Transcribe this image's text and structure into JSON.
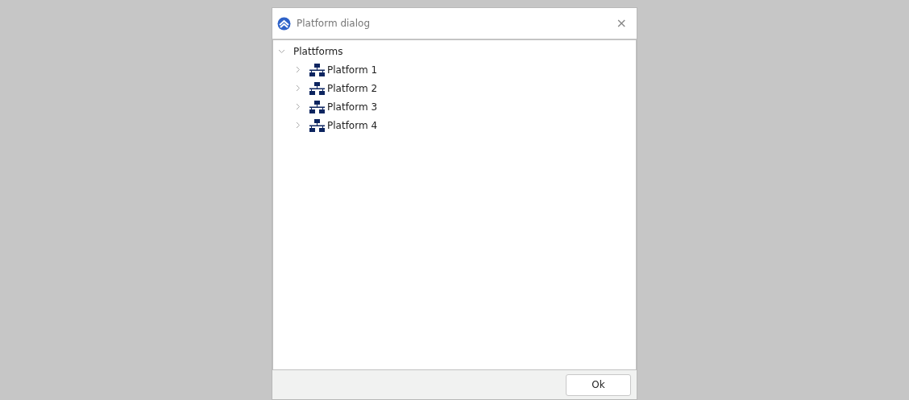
{
  "window": {
    "title": "Platform dialog",
    "close": "×"
  },
  "tree": [
    {
      "label": "Plattforms",
      "expanded": true,
      "children": [
        {
          "label": "Platform 1",
          "kind": "platform",
          "expanded": false
        },
        {
          "label": "Platform 2",
          "kind": "platform",
          "expanded": false
        },
        {
          "label": "Platform 3",
          "kind": "platform",
          "expanded": false
        },
        {
          "label": "Platform 4",
          "kind": "platform",
          "expanded": false
        }
      ]
    }
  ],
  "buttons": [
    "Ok"
  ]
}
